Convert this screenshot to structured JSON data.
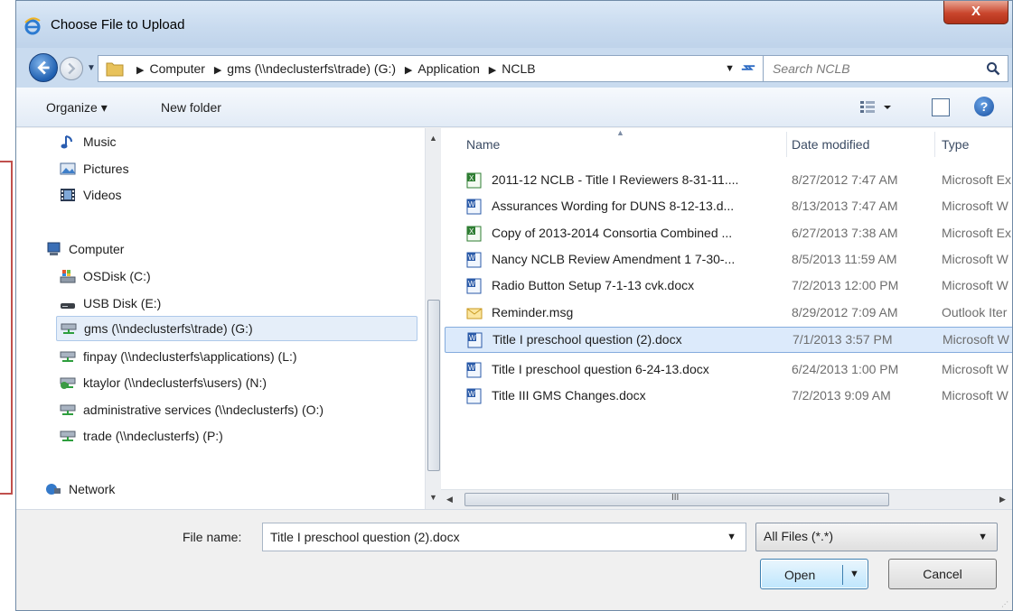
{
  "window": {
    "title": "Choose File to Upload",
    "close_glyph": "X"
  },
  "address_bar": {
    "crumbs": [
      "Computer",
      "gms (\\\\ndeclusterfs\\trade) (G:)",
      "Application",
      "NCLB"
    ],
    "search_placeholder": "Search NCLB"
  },
  "toolbar": {
    "organize_label": "Organize ▾",
    "new_folder_label": "New folder",
    "help_glyph": "?"
  },
  "nav_pane": {
    "items": [
      {
        "label": "Music",
        "icon": "music-icon"
      },
      {
        "label": "Pictures",
        "icon": "pictures-icon"
      },
      {
        "label": "Videos",
        "icon": "videos-icon"
      },
      {
        "label": "Computer",
        "icon": "computer-icon"
      },
      {
        "label": "OSDisk (C:)",
        "icon": "disk-icon"
      },
      {
        "label": "USB Disk (E:)",
        "icon": "usb-disk-icon"
      },
      {
        "label": "gms (\\\\ndeclusterfs\\trade) (G:)",
        "icon": "network-drive-icon",
        "selected": true
      },
      {
        "label": "finpay (\\\\ndeclusterfs\\applications) (L:)",
        "icon": "network-drive-icon"
      },
      {
        "label": "ktaylor (\\\\ndeclusterfs\\users) (N:)",
        "icon": "network-drive-icon"
      },
      {
        "label": "administrative services (\\\\ndeclusterfs) (O:)",
        "icon": "network-drive-icon"
      },
      {
        "label": "trade (\\\\ndeclusterfs) (P:)",
        "icon": "network-drive-icon"
      },
      {
        "label": "Network",
        "icon": "network-icon"
      }
    ]
  },
  "file_list": {
    "columns": {
      "name": "Name",
      "date": "Date modified",
      "type": "Type"
    },
    "rows": [
      {
        "name": "2011-12 NCLB - Title I Reviewers 8-31-11....",
        "date": "8/27/2012 7:47 AM",
        "type": "Microsoft Ex",
        "icon": "excel-file-icon"
      },
      {
        "name": "Assurances Wording for DUNS 8-12-13.d...",
        "date": "8/13/2013 7:47 AM",
        "type": "Microsoft W",
        "icon": "word-file-icon"
      },
      {
        "name": "Copy of 2013-2014 Consortia Combined ...",
        "date": "6/27/2013 7:38 AM",
        "type": "Microsoft Ex",
        "icon": "excel-file-icon"
      },
      {
        "name": "Nancy NCLB Review Amendment 1 7-30-...",
        "date": "8/5/2013 11:59 AM",
        "type": "Microsoft W",
        "icon": "word-file-icon"
      },
      {
        "name": "Radio Button Setup 7-1-13 cvk.docx",
        "date": "7/2/2013 12:00 PM",
        "type": "Microsoft W",
        "icon": "word-file-icon"
      },
      {
        "name": "Reminder.msg",
        "date": "8/29/2012 7:09 AM",
        "type": "Outlook Iter",
        "icon": "mail-file-icon"
      },
      {
        "name": "Title I preschool question (2).docx",
        "date": "7/1/2013 3:57 PM",
        "type": "Microsoft W",
        "icon": "word-file-icon",
        "selected": true
      },
      {
        "name": "Title I preschool question 6-24-13.docx",
        "date": "6/24/2013 1:00 PM",
        "type": "Microsoft W",
        "icon": "word-file-icon"
      },
      {
        "name": "Title III GMS Changes.docx",
        "date": "7/2/2013 9:09 AM",
        "type": "Microsoft W",
        "icon": "word-file-icon"
      }
    ]
  },
  "footer": {
    "file_name_label": "File name:",
    "file_name_value": "Title I preschool question (2).docx",
    "file_type_value": "All Files (*.*)",
    "open_label": "Open",
    "cancel_label": "Cancel",
    "scroll_grip_glyph": "III"
  },
  "colors": {
    "titlebar": "#c9dbef",
    "close_button": "#c9452c",
    "selection": "#dceafb",
    "accent": "#3c7fb1",
    "annotation_bracket": "#c0504d"
  }
}
